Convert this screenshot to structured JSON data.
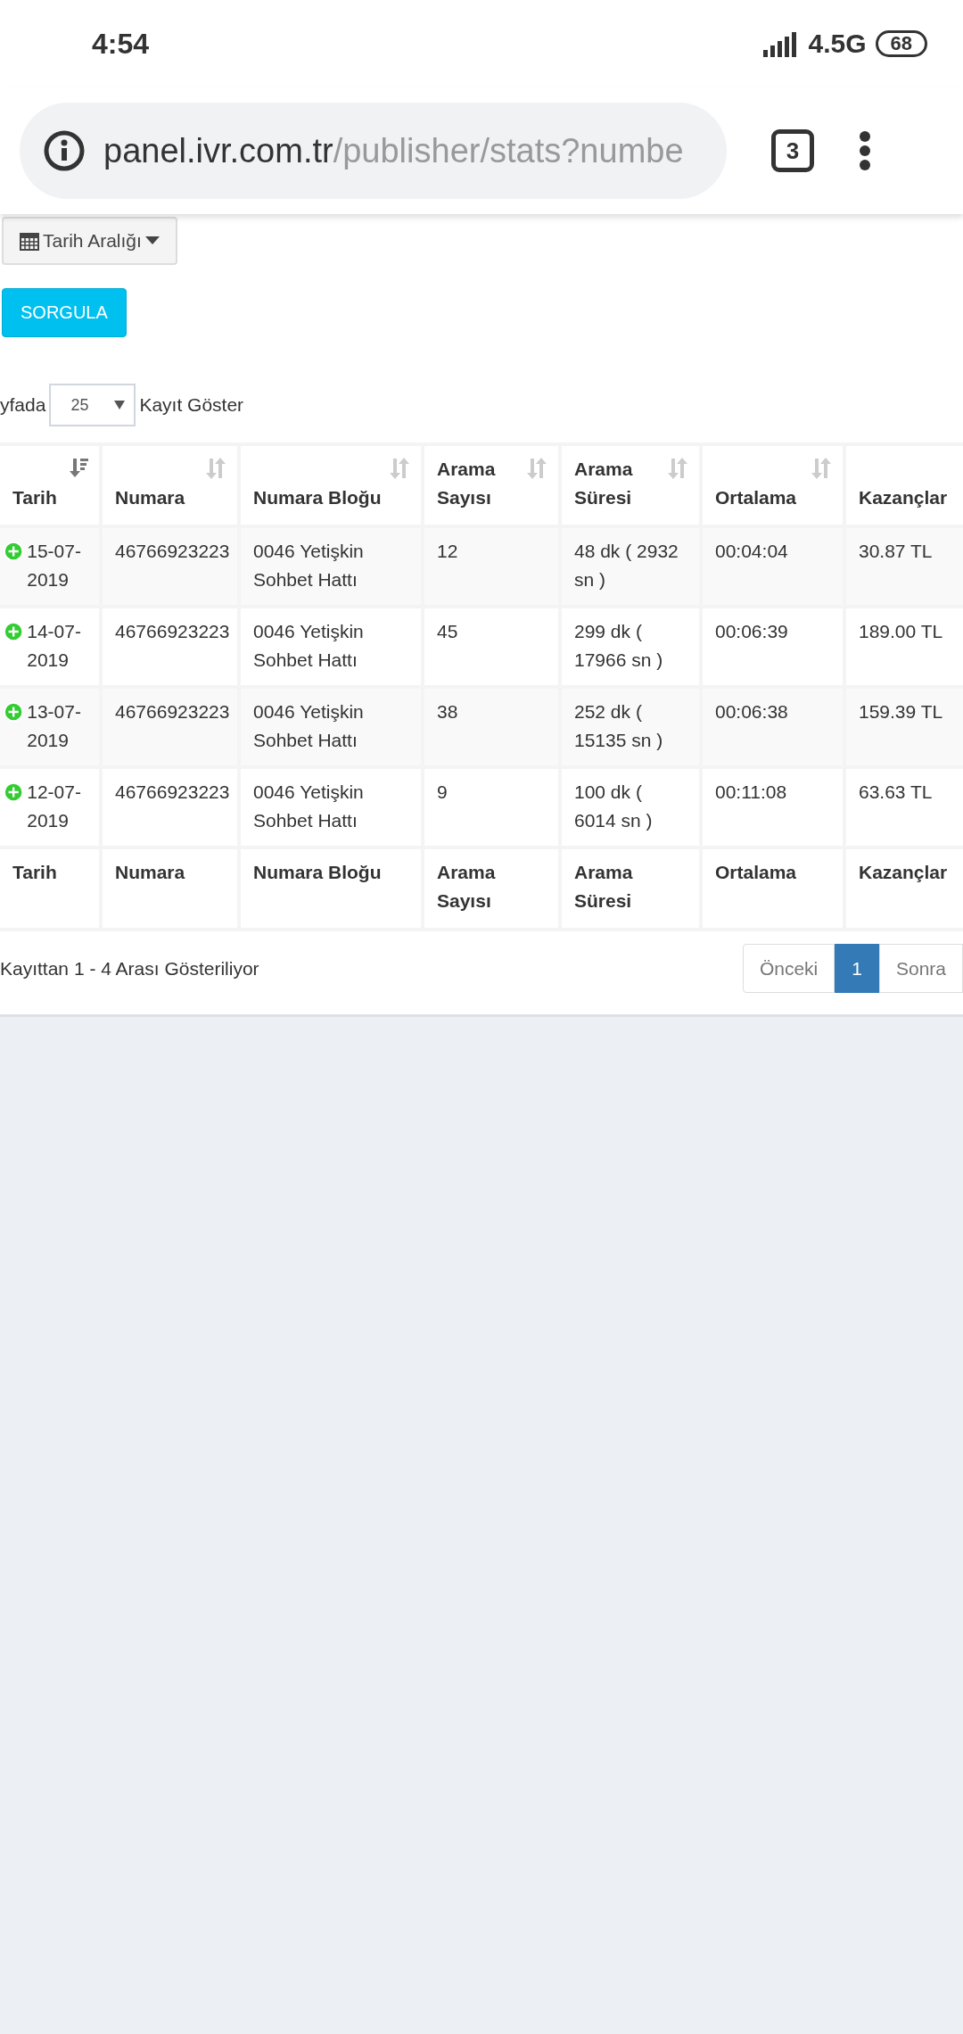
{
  "status_bar": {
    "time": "4:54",
    "network": "4.5G",
    "battery": "68"
  },
  "browser": {
    "url_host": "panel.ivr.com.tr",
    "url_path": "/publisher/stats?numbe",
    "tab_count": "3"
  },
  "filters": {
    "date_range_button": "Tarih Aralığı",
    "query_button": "SORGULA"
  },
  "page_length": {
    "prefix": "yfada",
    "value": "25",
    "suffix": "Kayıt Göster"
  },
  "table": {
    "columns": [
      {
        "label": "Tarih",
        "sortable": true,
        "sorted": true
      },
      {
        "label": "Numara",
        "sortable": true,
        "sorted": false
      },
      {
        "label": "Numara Bloğu",
        "sortable": true,
        "sorted": false
      },
      {
        "label": "Arama Sayısı",
        "sortable": true,
        "sorted": false
      },
      {
        "label": "Arama Süresi",
        "sortable": true,
        "sorted": false
      },
      {
        "label": "Ortalama",
        "sortable": true,
        "sorted": false
      },
      {
        "label": "Kazançlar"
      }
    ],
    "rows": [
      {
        "cells": [
          "15-07-2019",
          "46766923223",
          "0046 Yetişkin Sohbet Hattı",
          "12",
          "48 dk ( 2932 sn )",
          "00:04:04",
          "30.87 TL"
        ]
      },
      {
        "cells": [
          "14-07-2019",
          "46766923223",
          "0046 Yetişkin Sohbet Hattı",
          "45",
          "299 dk ( 17966 sn )",
          "00:06:39",
          "189.00 TL"
        ]
      },
      {
        "cells": [
          "13-07-2019",
          "46766923223",
          "0046 Yetişkin Sohbet Hattı",
          "38",
          "252 dk ( 15135 sn )",
          "00:06:38",
          "159.39 TL"
        ]
      },
      {
        "cells": [
          "12-07-2019",
          "46766923223",
          "0046 Yetişkin Sohbet Hattı",
          "9",
          "100 dk ( 6014 sn )",
          "00:11:08",
          "63.63 TL"
        ]
      }
    ],
    "footer_columns": [
      "Tarih",
      "Numara",
      "Numara Bloğu",
      "Arama Sayısı",
      "Arama Süresi",
      "Ortalama",
      "Kazançlar"
    ]
  },
  "info": "Kayıttan 1 - 4 Arası Gösteriliyor",
  "pagination": [
    {
      "label": "Önceki",
      "selected": false
    },
    {
      "label": "1",
      "selected": true
    },
    {
      "label": "Sonra",
      "selected": false
    }
  ]
}
